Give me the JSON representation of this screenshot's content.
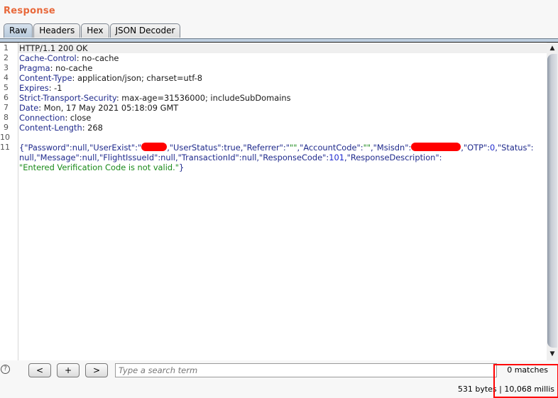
{
  "panel": {
    "title": "Response"
  },
  "tabs": [
    {
      "label": "Raw",
      "active": true
    },
    {
      "label": "Headers",
      "active": false
    },
    {
      "label": "Hex",
      "active": false
    },
    {
      "label": "JSON Decoder",
      "active": false
    }
  ],
  "editor": {
    "line_numbers": [
      "1",
      "2",
      "3",
      "4",
      "5",
      "6",
      "7",
      "8",
      "9",
      "10",
      "11"
    ],
    "status_line": "HTTP/1.1 200 OK",
    "headers": [
      {
        "name": "Cache-Control",
        "value": " no-cache"
      },
      {
        "name": "Pragma",
        "value": " no-cache"
      },
      {
        "name": "Content-Type",
        "value": " application/json; charset=utf-8"
      },
      {
        "name": "Expires",
        "value": " -1"
      },
      {
        "name": "Strict-Transport-Security",
        "value": " max-age=31536000; includeSubDomains"
      },
      {
        "name": "Date",
        "value": " Mon, 17 May 2021 05:18:09 GMT"
      },
      {
        "name": "Connection",
        "value": " close"
      },
      {
        "name": "Content-Length",
        "value": " 268"
      }
    ],
    "body": {
      "l1a": "{\"Password\":null,\"UserExist\":\"",
      "l1b": ",\"UserStatus\":true,\"Referrer\":\"",
      "l1c": "\"\"",
      "l1d": ",\"AccountCode\":",
      "l1e": "\"\"",
      "l1f": ",\"Msisdn\":",
      "l1g": ",\"OTP\":",
      "l1h": "0",
      "l1i": ",\"Status\":",
      "l2a": "null,\"Message\":null,\"FlightIssueId\":null,\"TransactionId\":null,\"ResponseCode\":",
      "l2b": "101",
      "l2c": ",\"ResponseDescription\":",
      "l3": "\"Entered Verification Code is not valid.\"",
      "l3end": "}"
    }
  },
  "search": {
    "help_label": "?",
    "prev_label": "<",
    "add_label": "+",
    "next_label": ">",
    "placeholder": "Type a search term",
    "matches": "0 matches"
  },
  "status": {
    "size_and_time": "531 bytes | 10,068 millis"
  },
  "colors": {
    "title": "#e8683a",
    "highlight_box": "#ff0000",
    "redaction": "#ff0000"
  }
}
